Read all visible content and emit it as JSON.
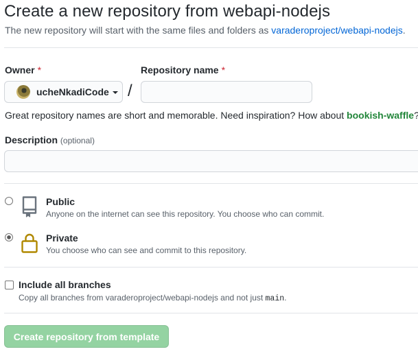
{
  "header": {
    "title": "Create a new repository from webapi-nodejs",
    "subtitle_prefix": "The new repository will start with the same files and folders as ",
    "template_link": "varaderoproject/webapi-nodejs",
    "subtitle_suffix": "."
  },
  "owner": {
    "label": "Owner",
    "required_mark": "*",
    "selected": "ucheNkadiCode"
  },
  "separator": "/",
  "repo_name": {
    "label": "Repository name",
    "required_mark": "*",
    "value": "",
    "placeholder": ""
  },
  "hint": {
    "prefix": "Great repository names are short and memorable. Need inspiration? How about ",
    "suggestion": "bookish-waffle",
    "suffix": "?"
  },
  "description": {
    "label": "Description",
    "optional_note": "(optional)",
    "value": "",
    "placeholder": ""
  },
  "visibility": {
    "selected": "private",
    "options": [
      {
        "id": "public",
        "title": "Public",
        "description": "Anyone on the internet can see this repository. You choose who can commit.",
        "icon": "repo-icon"
      },
      {
        "id": "private",
        "title": "Private",
        "description": "You choose who can see and commit to this repository.",
        "icon": "lock-icon"
      }
    ]
  },
  "include_branches": {
    "label": "Include all branches",
    "checked": false,
    "description_prefix": "Copy all branches from varaderoproject/webapi-nodejs and not just ",
    "branch_name": "main",
    "description_suffix": "."
  },
  "submit": {
    "label": "Create repository from template",
    "enabled": false
  },
  "colors": {
    "link": "#0366d6",
    "suggestion": "#22863a",
    "required": "#cb2431",
    "lock_icon": "#b08800",
    "submit_disabled_bg": "#94d3a2"
  }
}
